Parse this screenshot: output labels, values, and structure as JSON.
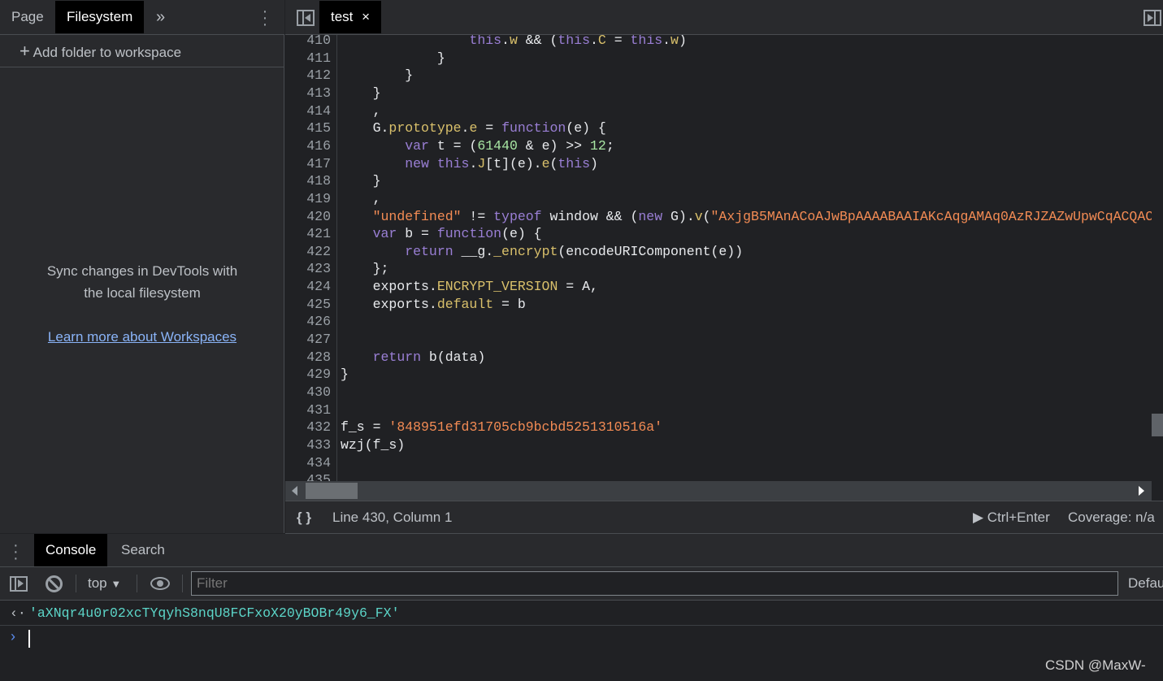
{
  "navigator": {
    "tabs": [
      "Page",
      "Filesystem"
    ],
    "active": "Filesystem",
    "more": "»",
    "add_folder": "Add folder to workspace",
    "sync_line1": "Sync changes in DevTools with",
    "sync_line2": "the local filesystem",
    "learn_more": "Learn more about Workspaces"
  },
  "editor": {
    "tab": "test",
    "close": "×",
    "lines": [
      {
        "n": "410",
        "t": [
          [
            "                ",
            ""
          ],
          [
            "this",
            "kw"
          ],
          [
            ".",
            ""
          ],
          [
            "w",
            "pr"
          ],
          [
            " && (",
            ""
          ],
          [
            "this",
            "kw"
          ],
          [
            ".",
            ""
          ],
          [
            "C",
            "pr"
          ],
          [
            " = ",
            ""
          ],
          [
            "this",
            "kw"
          ],
          [
            ".",
            ""
          ],
          [
            "w",
            "pr"
          ],
          [
            ")",
            ""
          ]
        ]
      },
      {
        "n": "411",
        "t": [
          [
            "            }",
            ""
          ]
        ]
      },
      {
        "n": "412",
        "t": [
          [
            "        }",
            ""
          ]
        ]
      },
      {
        "n": "413",
        "t": [
          [
            "    }",
            ""
          ]
        ]
      },
      {
        "n": "414",
        "t": [
          [
            "    ,",
            ""
          ]
        ]
      },
      {
        "n": "415",
        "t": [
          [
            "    G.",
            ""
          ],
          [
            "prototype",
            "pr"
          ],
          [
            ".",
            ""
          ],
          [
            "e",
            "pr"
          ],
          [
            " = ",
            ""
          ],
          [
            "function",
            "kw"
          ],
          [
            "(e) {",
            ""
          ]
        ]
      },
      {
        "n": "416",
        "t": [
          [
            "        ",
            ""
          ],
          [
            "var",
            "kw"
          ],
          [
            " t = (",
            ""
          ],
          [
            "61440",
            "nu"
          ],
          [
            " & e) >> ",
            ""
          ],
          [
            "12",
            "nu"
          ],
          [
            ";",
            ""
          ]
        ]
      },
      {
        "n": "417",
        "t": [
          [
            "        ",
            ""
          ],
          [
            "new",
            "kw"
          ],
          [
            " ",
            ""
          ],
          [
            "this",
            "kw"
          ],
          [
            ".",
            ""
          ],
          [
            "J",
            "pr"
          ],
          [
            "[t](e).",
            ""
          ],
          [
            "e",
            "pr"
          ],
          [
            "(",
            ""
          ],
          [
            "this",
            "kw"
          ],
          [
            ")",
            ""
          ]
        ]
      },
      {
        "n": "418",
        "t": [
          [
            "    }",
            ""
          ]
        ]
      },
      {
        "n": "419",
        "t": [
          [
            "    ,",
            ""
          ]
        ]
      },
      {
        "n": "420",
        "t": [
          [
            "    ",
            ""
          ],
          [
            "\"undefined\"",
            "st"
          ],
          [
            " != ",
            ""
          ],
          [
            "typeof",
            "kw"
          ],
          [
            " window && (",
            ""
          ],
          [
            "new",
            "kw"
          ],
          [
            " G).",
            ""
          ],
          [
            "v",
            "pr"
          ],
          [
            "(",
            ""
          ],
          [
            "\"AxjgB5MAnACoAJwBpAAAABAAIAKcAqgAMAq0AzRJZAZwUpwCqACQAC",
            "st"
          ]
        ]
      },
      {
        "n": "421",
        "t": [
          [
            "    ",
            ""
          ],
          [
            "var",
            "kw"
          ],
          [
            " b = ",
            ""
          ],
          [
            "function",
            "kw"
          ],
          [
            "(e) {",
            ""
          ]
        ]
      },
      {
        "n": "422",
        "t": [
          [
            "        ",
            ""
          ],
          [
            "return",
            "kw"
          ],
          [
            " __g.",
            ""
          ],
          [
            "_encrypt",
            "pr"
          ],
          [
            "(encodeURIComponent(e))",
            ""
          ]
        ]
      },
      {
        "n": "423",
        "t": [
          [
            "    };",
            ""
          ]
        ]
      },
      {
        "n": "424",
        "t": [
          [
            "    exports.",
            ""
          ],
          [
            "ENCRYPT_VERSION",
            "pr"
          ],
          [
            " = A,",
            ""
          ]
        ]
      },
      {
        "n": "425",
        "t": [
          [
            "    exports.",
            ""
          ],
          [
            "default",
            "pr"
          ],
          [
            " = b",
            ""
          ]
        ]
      },
      {
        "n": "426",
        "t": []
      },
      {
        "n": "427",
        "t": []
      },
      {
        "n": "428",
        "t": [
          [
            "    ",
            ""
          ],
          [
            "return",
            "kw"
          ],
          [
            " b(data)",
            ""
          ]
        ]
      },
      {
        "n": "429",
        "t": [
          [
            "}",
            ""
          ]
        ]
      },
      {
        "n": "430",
        "t": []
      },
      {
        "n": "431",
        "t": []
      },
      {
        "n": "432",
        "t": [
          [
            "f_s = ",
            ""
          ],
          [
            "'848951efd31705cb9bcbd5251310516a'",
            "st"
          ]
        ]
      },
      {
        "n": "433",
        "t": [
          [
            "wzj(f_s)",
            ""
          ]
        ]
      },
      {
        "n": "434",
        "t": []
      },
      {
        "n": "435",
        "t": []
      }
    ],
    "status": {
      "pretty": "{ }",
      "position": "Line 430, Column 1",
      "run": "Ctrl+Enter",
      "coverage": "Coverage: n/a"
    }
  },
  "drawer": {
    "tabs": [
      "Console",
      "Search"
    ],
    "active": "Console",
    "context": "top",
    "filter_placeholder": "Filter",
    "levels": "Defau",
    "result": "'aXNqr4u0r02xcTYqyhS8nqU8FCFxoX20yBOBr49y6_FX'"
  },
  "watermark": "CSDN @MaxW-",
  "colors": {
    "keyword": "#9a7fd5",
    "property": "#d9c06b",
    "string": "#f28b54",
    "number": "#a8e6a3",
    "result": "#5cd5c8"
  }
}
